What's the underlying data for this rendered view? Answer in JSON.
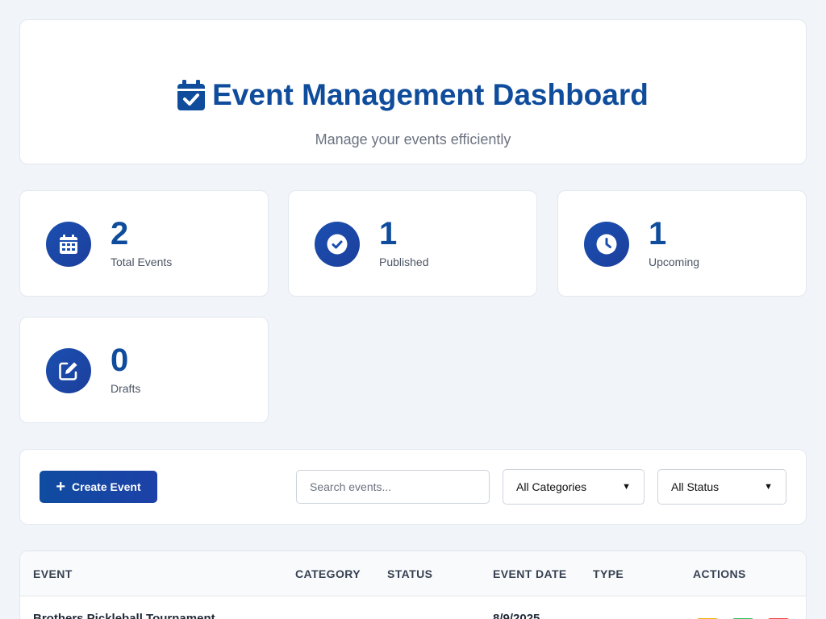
{
  "header": {
    "title": "Event Management Dashboard",
    "subtitle": "Manage your events efficiently",
    "icon": "calendar-check-icon"
  },
  "stats": [
    {
      "value": "2",
      "label": "Total Events",
      "icon": "calendar-icon"
    },
    {
      "value": "1",
      "label": "Published",
      "icon": "check-circle-icon"
    },
    {
      "value": "1",
      "label": "Upcoming",
      "icon": "clock-icon"
    },
    {
      "value": "0",
      "label": "Drafts",
      "icon": "edit-icon"
    }
  ],
  "toolbar": {
    "create_label": "Create Event",
    "search_placeholder": "Search events...",
    "search_value": "",
    "category_selected": "All Categories",
    "status_selected": "All Status"
  },
  "table": {
    "columns": [
      "EVENT",
      "CATEGORY",
      "STATUS",
      "EVENT DATE",
      "TYPE",
      "ACTIONS"
    ],
    "rows": [
      {
        "event": "Brothers Pickleball Tournament",
        "category": "",
        "status": "",
        "date": "8/9/2025",
        "type": ""
      }
    ]
  },
  "colors": {
    "accent": "#0f4c9c",
    "background": "#f1f4f9",
    "action_view": "#eab308",
    "action_edit": "#22c55e",
    "action_delete": "#ef4444"
  }
}
